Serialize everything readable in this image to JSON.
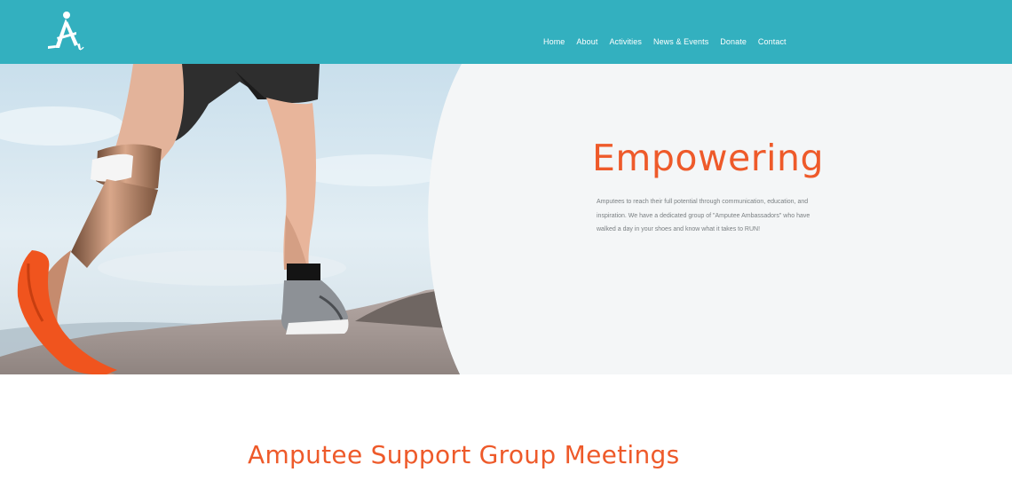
{
  "brand": {
    "logo_icon": "amputee-runner-a-logo-icon"
  },
  "nav": {
    "items": [
      {
        "label": "Home"
      },
      {
        "label": "About"
      },
      {
        "label": "Activities"
      },
      {
        "label": "News & Events"
      },
      {
        "label": "Donate"
      },
      {
        "label": "Contact"
      }
    ]
  },
  "hero": {
    "title": "Empowering",
    "text": "Amputees to reach their full potential through communication, education, and inspiration. We have a dedicated group of \"Amputee Ambassadors\" who have walked a day in your shoes and know what it takes to RUN!",
    "image": "runner-with-prosthetic-leg-image"
  },
  "section": {
    "title": "Amputee Support Group Meetings"
  },
  "colors": {
    "header_bg": "#33b0bf",
    "accent": "#ee5a2a",
    "hero_bg": "#f4f6f7",
    "body_text": "#7a7f82"
  }
}
